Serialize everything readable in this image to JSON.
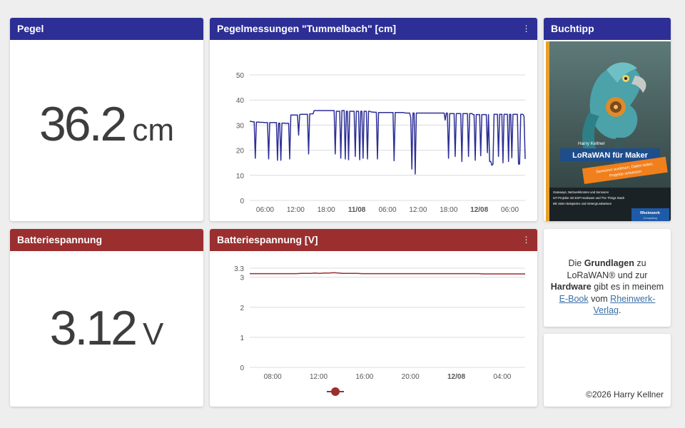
{
  "pegel_card": {
    "title": "Pegel",
    "value": "36.2",
    "unit": "cm"
  },
  "pegel_chart_card": {
    "title": "Pegelmessungen \"Tummelbach\" [cm]",
    "menu": "⋮",
    "chart_data": {
      "type": "line",
      "title": "",
      "ylim": [
        0,
        50
      ],
      "yticks": [
        "0",
        "10",
        "20",
        "30",
        "40",
        "50"
      ],
      "xticks": [
        "06:00",
        "12:00",
        "18:00",
        "11/08",
        "06:00",
        "12:00",
        "18:00",
        "12/08",
        "06:00"
      ],
      "xticks_bold": [
        false,
        false,
        false,
        true,
        false,
        false,
        false,
        true,
        false
      ],
      "series": [
        {
          "color": "#2d2f96",
          "values": [
            31.5,
            31.5,
            31.4,
            31.3,
            31.3,
            16.8,
            31.2,
            31.2,
            31.2,
            31.1,
            31.1,
            31.1,
            31.1,
            31,
            31,
            31,
            31,
            16.5,
            31,
            31,
            31,
            31,
            31,
            31,
            31,
            16,
            30.8,
            30.8,
            16,
            30.8,
            30.8,
            30.8,
            30.7,
            30.7,
            30.7,
            30.7,
            16.5,
            34,
            34,
            34,
            34,
            34,
            34,
            34,
            26,
            34.2,
            34.3,
            34.3,
            34.3,
            34.3,
            34.3,
            34.3,
            34.3,
            18.5,
            34.5,
            34.5,
            34.5,
            34.5,
            35.8,
            35.8,
            35.8,
            35.8,
            35.8,
            35.8,
            35.8,
            35.8,
            35.8,
            35.8,
            35.8,
            35.8,
            35.8,
            35.8,
            35.8,
            35.8,
            35.8,
            35.8,
            35.8,
            18.5,
            35.5,
            35.5,
            35.5,
            35.5,
            16.8,
            35.8,
            35.8,
            35.8,
            16.5,
            35.5,
            35.5,
            16.2,
            35.5,
            35.5,
            35.5,
            35.5,
            35.5,
            17.5,
            35.5,
            35.5,
            35.5,
            16.2,
            35.5,
            35.5,
            16.8,
            35.5,
            35.5,
            35.5,
            16.5,
            35.5,
            35.5,
            35.3,
            35.2,
            35.2,
            35.1,
            35.1,
            35.1,
            16.5,
            35,
            35,
            35,
            35,
            35,
            35,
            35,
            35,
            35,
            35,
            35,
            35,
            35,
            35,
            15.8,
            35,
            35,
            35,
            35,
            35,
            35,
            35,
            35,
            35,
            34.8,
            34.8,
            34.8,
            34.8,
            34.8,
            33,
            12.5,
            34.8,
            34.8,
            10.5,
            34.8,
            34.8,
            34.8,
            34.8,
            34.8,
            34.8,
            34.8,
            34.8,
            34.8,
            34.8,
            34.8,
            34.8,
            34.8,
            34.8,
            34.8,
            34.8,
            34.8,
            34.8,
            34.8,
            34.8,
            34.8,
            34.8,
            34.8,
            34.8,
            34.8,
            34.8,
            32,
            34.8,
            34.8,
            16.8,
            34.6,
            34.6,
            34.6,
            34.6,
            34.6,
            17.5,
            34.6,
            34.6,
            34.6,
            34.6,
            34.6,
            15.5,
            34.6,
            34.6,
            34.6,
            34.6,
            34.6,
            17.5,
            34.6,
            34.6,
            34.6,
            34.2,
            34.2,
            16,
            34.2,
            34.2,
            34.2,
            34.2,
            17.8,
            34.2,
            34.2,
            34.2,
            34.2,
            34.2,
            19,
            34.2,
            15.5,
            15.5,
            14,
            14.5,
            34.3,
            34.3,
            34.3,
            34.3,
            17.5,
            34.3,
            34.3,
            34.3,
            15,
            34.3,
            34.3,
            34.3,
            34.3,
            15.5,
            34.3,
            34.3,
            17,
            34.3,
            34.3,
            34.3,
            34.3,
            34.3,
            14.5,
            14.5,
            34.3,
            34.3,
            34.3,
            33.5,
            16.5
          ]
        }
      ]
    }
  },
  "book_card": {
    "title": "Buchtipp",
    "cover": {
      "author": "Harry Kellner",
      "book_title": "LoRaWAN für Maker",
      "tagline_1": "Sensoren auslesen, Daten teilen,",
      "tagline_2": "Projekte umsetzen",
      "bullet_1": "Gateways, Netzwerkknoten und Sensoren",
      "bullet_2": "IoT-Projekte mit ESP-Hardware und The Things Stack",
      "bullet_3": "Mit vielen Beispielen und Hintergrundwissen",
      "publisher": "Rheinwerk",
      "publisher_sub": "Computing"
    }
  },
  "battery_card": {
    "title": "Batteriespannung",
    "value": "3.12",
    "unit": "V"
  },
  "battery_chart_card": {
    "title": "Batteriespannung [V]",
    "menu": "⋮",
    "chart_data": {
      "type": "line",
      "title": "",
      "ylim": [
        0,
        3.3
      ],
      "yticks": [
        "0",
        "1",
        "2",
        "3",
        "3.3"
      ],
      "xticks": [
        "08:00",
        "12:00",
        "16:00",
        "20:00",
        "12/08",
        "04:00"
      ],
      "xticks_bold": [
        false,
        false,
        false,
        false,
        true,
        false
      ],
      "series": [
        {
          "color": "#9b2f2f",
          "values": [
            3.12,
            3.12,
            3.12,
            3.12,
            3.12,
            3.12,
            3.12,
            3.12,
            3.12,
            3.12,
            3.12,
            3.13,
            3.13,
            3.13,
            3.14,
            3.13,
            3.14,
            3.14,
            3.15,
            3.14,
            3.13,
            3.13,
            3.13,
            3.13,
            3.12,
            3.12,
            3.12,
            3.12,
            3.12,
            3.12,
            3.12,
            3.12,
            3.12,
            3.12,
            3.12,
            3.12,
            3.12,
            3.12,
            3.12,
            3.12,
            3.12,
            3.12,
            3.12,
            3.12,
            3.12,
            3.12,
            3.12,
            3.12,
            3.12,
            3.12,
            3.11,
            3.11,
            3.11,
            3.11,
            3.11,
            3.11,
            3.11,
            3.11,
            3.11,
            3.11
          ]
        }
      ]
    }
  },
  "info_card": {
    "text_1": "Die ",
    "bold_1": "Grundlagen",
    "text_2": " zu LoRaWAN® und zur ",
    "bold_2": "Hardware",
    "text_3": " gibt es in meinem ",
    "link_1": "E-Book",
    "text_4": " vom ",
    "link_2": "Rheinwerk-Verlag",
    "text_5": "."
  },
  "footer_card": {
    "copyright": "©2026 Harry Kellner"
  }
}
